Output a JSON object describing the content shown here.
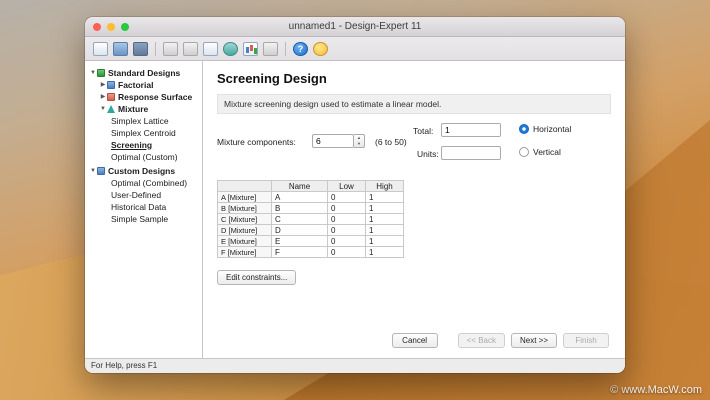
{
  "desktop": {
    "watermark": "© www.MacW.com"
  },
  "window": {
    "title": "unnamed1 - Design-Expert 11",
    "status_bar": "For Help, press F1"
  },
  "toolbar": {
    "icons": [
      "new-file",
      "open-file",
      "save-file",
      "copy",
      "paste",
      "report",
      "charts",
      "analysis",
      "design-summary",
      "help",
      "tips"
    ]
  },
  "sidebar": {
    "items": [
      {
        "label": "Standard Designs"
      },
      {
        "label": "Factorial"
      },
      {
        "label": "Response Surface"
      },
      {
        "label": "Mixture"
      },
      {
        "label": "Simplex Lattice"
      },
      {
        "label": "Simplex Centroid"
      },
      {
        "label": "Screening",
        "selected": true
      },
      {
        "label": "Optimal (Custom)"
      },
      {
        "label": "Custom Designs"
      },
      {
        "label": "Optimal (Combined)"
      },
      {
        "label": "User-Defined"
      },
      {
        "label": "Historical Data"
      },
      {
        "label": "Simple Sample"
      }
    ]
  },
  "main": {
    "title": "Screening Design",
    "description": "Mixture screening design used to estimate a linear model.",
    "form": {
      "mixture_components_label": "Mixture components:",
      "mixture_components_value": "6",
      "range_hint": "(6 to 50)",
      "total_label": "Total:",
      "total_value": "1",
      "units_label": "Units:",
      "units_value": "",
      "horizontal_label": "Horizontal",
      "vertical_label": "Vertical"
    },
    "table": {
      "headers": {
        "component": "",
        "name": "Name",
        "low": "Low",
        "high": "High"
      },
      "rows": [
        {
          "component": "A [Mixture]",
          "name": "A",
          "low": "0",
          "high": "1"
        },
        {
          "component": "B [Mixture]",
          "name": "B",
          "low": "0",
          "high": "1"
        },
        {
          "component": "C [Mixture]",
          "name": "C",
          "low": "0",
          "high": "1"
        },
        {
          "component": "D [Mixture]",
          "name": "D",
          "low": "0",
          "high": "1"
        },
        {
          "component": "E [Mixture]",
          "name": "E",
          "low": "0",
          "high": "1"
        },
        {
          "component": "F [Mixture]",
          "name": "F",
          "low": "0",
          "high": "1"
        }
      ]
    },
    "edit_constraints_label": "Edit constraints...",
    "footer": {
      "cancel": "Cancel",
      "back": "<< Back",
      "next": "Next >>",
      "finish": "Finish"
    }
  },
  "colors": {
    "accent_blue": "#1f7ad6",
    "traffic_red": "#ff5f57",
    "traffic_yellow": "#febc2e",
    "traffic_green": "#28c840"
  }
}
